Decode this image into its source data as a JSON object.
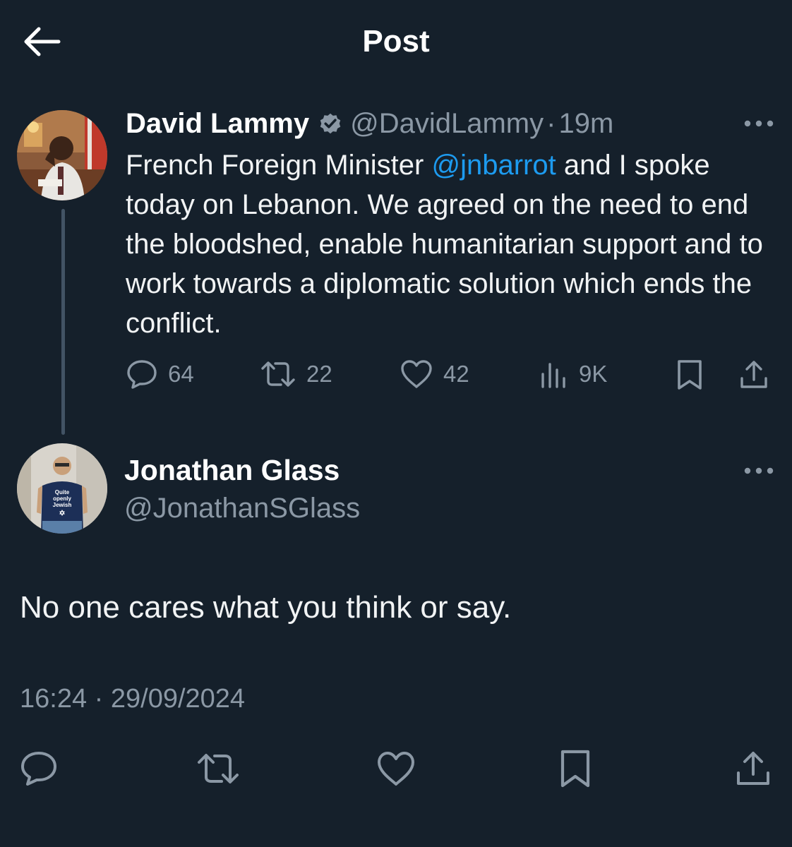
{
  "header": {
    "title": "Post"
  },
  "original_post": {
    "display_name": "David Lammy",
    "handle": "@DavidLammy",
    "separator": "·",
    "time": "19m",
    "text_before_mention": "French Foreign Minister ",
    "mention": "@jnbarrot",
    "text_after_mention": " and I spoke today on Lebanon. We agreed on the need to end the bloodshed, enable humanitarian support and to work towards a diplomatic solution which ends the conflict.",
    "metrics": {
      "replies": "64",
      "reposts": "22",
      "likes": "42",
      "views": "9K"
    }
  },
  "reply_post": {
    "display_name": "Jonathan Glass",
    "handle": "@JonathanSGlass",
    "text": "No one cares what you think or say.",
    "shirt_text": [
      "Quite",
      "openly",
      "Jewish"
    ],
    "timestamp": "16:24 · 29/09/2024"
  },
  "colors": {
    "background": "#15202b",
    "text": "#e7e9ea",
    "muted": "#8b98a5",
    "accent": "#1d9bf0"
  },
  "icons": {
    "back": "arrow-left-icon",
    "verified": "verified-badge-icon",
    "more": "more-horizontal-icon",
    "reply": "comment-icon",
    "repost": "repost-icon",
    "like": "heart-icon",
    "views": "views-bar-chart-icon",
    "bookmark": "bookmark-icon",
    "share": "share-icon"
  }
}
